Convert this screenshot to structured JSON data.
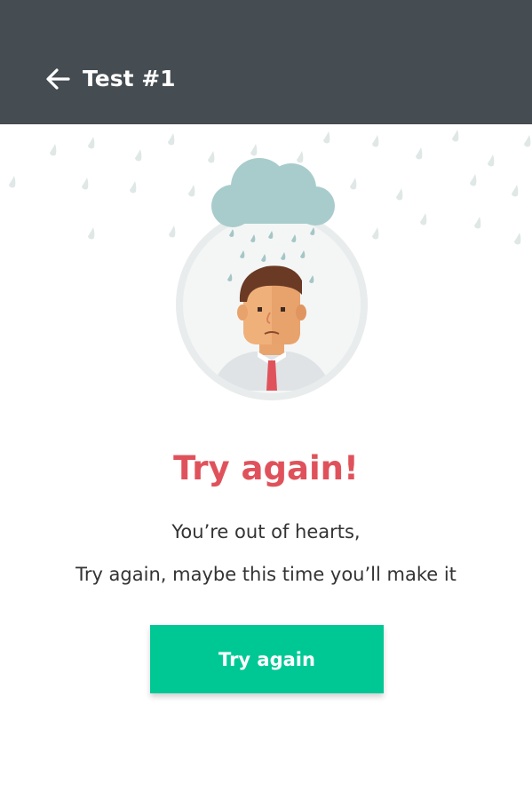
{
  "appbar": {
    "title": "Test #1",
    "back_icon": "arrow-left-icon",
    "background": "#454c52"
  },
  "illustration": {
    "description_icon": "rain-cloud-over-sad-man-icon"
  },
  "result": {
    "headline": "Try again!",
    "message_line1": "You’re out of hearts,",
    "message_line2": "Try again, maybe this time you’ll make it",
    "headline_color": "#e0525b"
  },
  "action": {
    "button_label": "Try again",
    "button_color": "#00c895"
  }
}
